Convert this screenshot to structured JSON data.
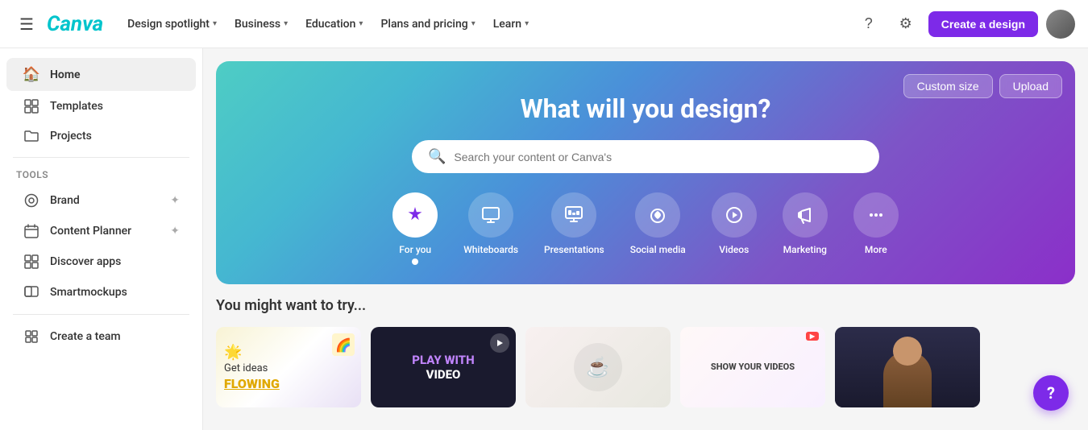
{
  "topnav": {
    "logo": "Canva",
    "nav_items": [
      {
        "id": "design-spotlight",
        "label": "Design spotlight",
        "has_chevron": true
      },
      {
        "id": "business",
        "label": "Business",
        "has_chevron": true
      },
      {
        "id": "education",
        "label": "Education",
        "has_chevron": true
      },
      {
        "id": "plans-pricing",
        "label": "Plans and pricing",
        "has_chevron": true
      },
      {
        "id": "learn",
        "label": "Learn",
        "has_chevron": true
      }
    ],
    "create_btn_label": "Create a design"
  },
  "sidebar": {
    "items": [
      {
        "id": "home",
        "label": "Home",
        "icon": "🏠",
        "active": true
      },
      {
        "id": "templates",
        "label": "Templates",
        "icon": "▭"
      },
      {
        "id": "projects",
        "label": "Projects",
        "icon": "📁"
      }
    ],
    "tools_label": "Tools",
    "tools_items": [
      {
        "id": "brand",
        "label": "Brand",
        "icon": "◈",
        "has_star": true
      },
      {
        "id": "content-planner",
        "label": "Content Planner",
        "icon": "📅",
        "has_star": true
      },
      {
        "id": "discover-apps",
        "label": "Discover apps",
        "icon": "⊞"
      },
      {
        "id": "smartmockups",
        "label": "Smartmockups",
        "icon": "◧"
      }
    ],
    "bottom_items": [
      {
        "id": "create-team",
        "label": "Create a team",
        "icon": "🏢"
      }
    ]
  },
  "hero": {
    "title": "What will you design?",
    "search_placeholder": "Search your content or Canva's",
    "custom_size_label": "Custom size",
    "upload_label": "Upload",
    "categories": [
      {
        "id": "for-you",
        "label": "For you",
        "icon": "✦",
        "active": true
      },
      {
        "id": "whiteboards",
        "label": "Whiteboards",
        "icon": "🖥"
      },
      {
        "id": "presentations",
        "label": "Presentations",
        "icon": "📊"
      },
      {
        "id": "social-media",
        "label": "Social media",
        "icon": "❤"
      },
      {
        "id": "videos",
        "label": "Videos",
        "icon": "▶"
      },
      {
        "id": "marketing",
        "label": "Marketing",
        "icon": "📣"
      },
      {
        "id": "more",
        "label": "More",
        "icon": "···"
      }
    ]
  },
  "suggestions": {
    "title": "You might want to try...",
    "cards": [
      {
        "id": "card-1",
        "type": "get-ideas",
        "line1": "Get ideas",
        "line2": "FLOWING"
      },
      {
        "id": "card-2",
        "type": "play-video",
        "line1": "PLAY WITH",
        "line2": "VIDEO"
      },
      {
        "id": "card-3",
        "type": "image",
        "label": ""
      },
      {
        "id": "card-4",
        "type": "show-videos",
        "label": "SHOW YOUR VIDEOS"
      },
      {
        "id": "card-5",
        "type": "person",
        "label": ""
      }
    ]
  },
  "help_btn": "?"
}
